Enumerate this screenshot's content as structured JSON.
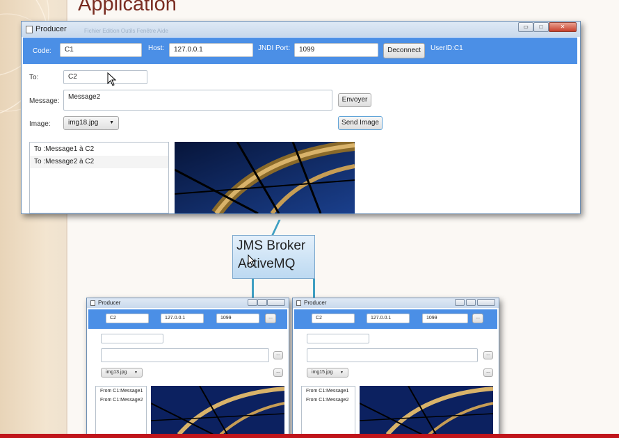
{
  "slide": {
    "title": "Application",
    "bottom_bar_color": "#c0151b"
  },
  "broker": {
    "line1": "JMS Broker",
    "line2": "ActiveMQ"
  },
  "main_window": {
    "title": "Producer",
    "menu_ghost": "Fichier  Edition  Outils  Fenêtre  Aide",
    "window_buttons": [
      "▭",
      "□",
      "✕"
    ],
    "connection": {
      "code_label": "Code:",
      "code_value": "C1",
      "host_label": "Host:",
      "host_value": "127.0.0.1",
      "port_label": "JNDI Port:",
      "port_value": "1099",
      "disconnect_label": "Deconnect",
      "user_id": "UserID:C1"
    },
    "to_label": "To:",
    "to_value": "C2",
    "message_label": "Message:",
    "message_value": "Message2",
    "send_label": "Envoyer",
    "image_label": "Image:",
    "image_selected": "img18.jpg",
    "send_image_label": "Send Image",
    "messages": [
      "To :Message1 à C2",
      "To :Message2 à C2"
    ]
  },
  "consumer_left": {
    "title": "Producer",
    "code_value": "C2",
    "host_value": "127.0.0.1",
    "port_value": "1099",
    "button_label": "...",
    "image_selected": "img13.jpg",
    "messages": [
      "From C1:Message1",
      "From C1:Message2"
    ]
  },
  "consumer_right": {
    "title": "Producer",
    "code_value": "C2",
    "host_value": "127.0.0.1",
    "port_value": "1099",
    "button_label": "...",
    "image_selected": "img15.jpg",
    "messages": [
      "From C1:Message1",
      "From C1:Message2"
    ]
  },
  "icons": [
    "app-icon",
    "minimize-icon",
    "maximize-icon",
    "close-icon",
    "dropdown-arrow-icon",
    "mouse-cursor-icon"
  ],
  "colors": {
    "toolbar_blue": "#4b8fe6",
    "title_text": "#7a2d22",
    "broker_fill": "#cfe4f6",
    "connector": "#3f9fc2"
  }
}
